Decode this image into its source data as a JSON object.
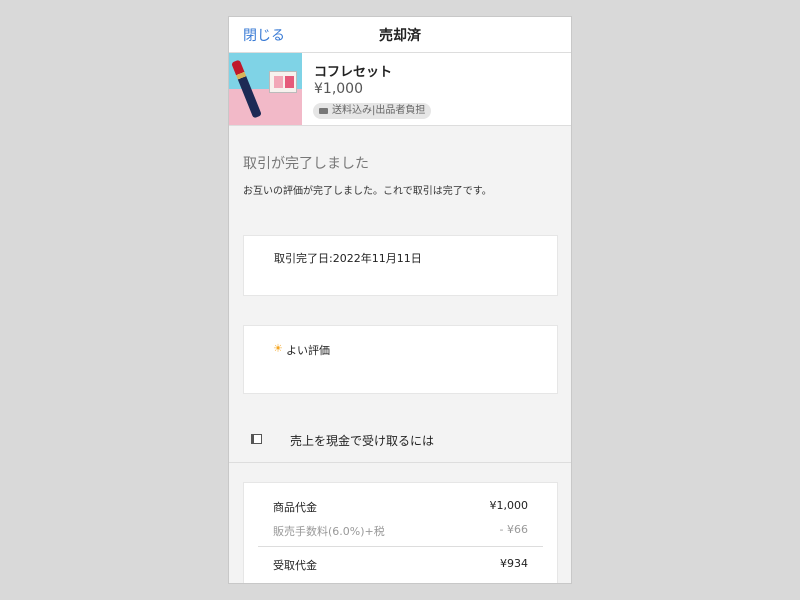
{
  "header": {
    "close_label": "閉じる",
    "title": "売却済"
  },
  "product": {
    "name": "コフレセット",
    "price": "¥1,000",
    "shipping_badge": "送料込み|出品者負担"
  },
  "status": {
    "heading": "取引が完了しました",
    "message": "お互いの評価が完了しました。これで取引は完了です。"
  },
  "completion": {
    "date_text": "取引完了日:2022年11月11日"
  },
  "rating": {
    "icon": "sun-icon",
    "label": "よい評価"
  },
  "cash_guide": {
    "icon": "book-icon",
    "label": "売上を現金で受け取るには"
  },
  "payout": {
    "rows": [
      {
        "label": "商品代金",
        "value": "¥1,000"
      },
      {
        "label": "販売手数料(6.0%)+税",
        "value": "- ¥66"
      },
      {
        "label": "受取代金",
        "value": "¥934"
      }
    ]
  },
  "colors": {
    "accent": "#3a7bd5",
    "rating_sun": "#f5a623",
    "background": "#f3f3f3"
  }
}
